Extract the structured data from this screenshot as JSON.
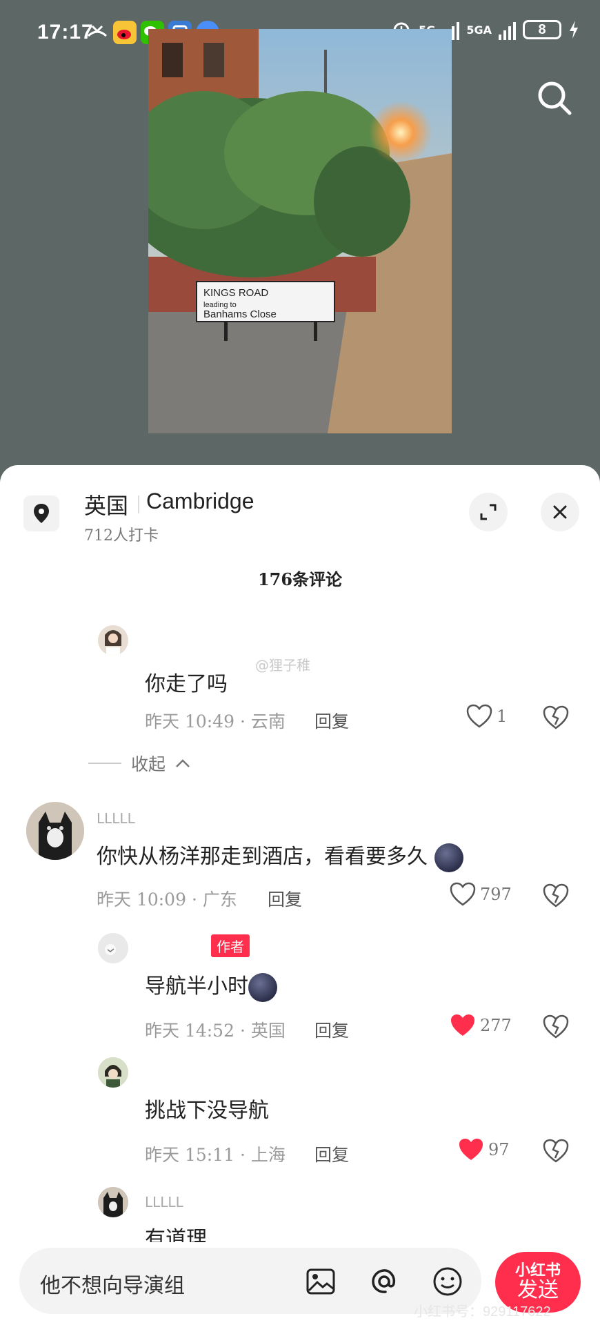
{
  "status_bar": {
    "time": "17:17",
    "network_1": "5G",
    "network_2": "5GA",
    "battery": "8"
  },
  "location": {
    "country": "英国",
    "city": "Cambridge",
    "checkins": "712人打卡"
  },
  "comments_count": "176条评论",
  "watermark": "@狸子稚",
  "comments": [
    {
      "text": "你走了吗",
      "time_location": "昨天 10:49 · 云南",
      "reply": "回复",
      "likes": "1",
      "liked": false
    },
    {
      "name": "LLLLL",
      "text": "你快从杨洋那走到酒店，看看要多久",
      "time_location": "昨天 10:09 · 广东",
      "reply": "回复",
      "likes": "797",
      "liked": false
    },
    {
      "badge": "作者",
      "text": "导航半小时",
      "time_location": "昨天 14:52 · 英国",
      "reply": "回复",
      "likes": "277",
      "liked": true
    },
    {
      "text": "挑战下没导航",
      "time_location": "昨天 15:11 · 上海",
      "reply": "回复",
      "likes": "97",
      "liked": true
    },
    {
      "name": "LLLLL",
      "text": "有道理"
    }
  ],
  "collapse_label": "收起",
  "input": {
    "value": "他不想向导演组"
  },
  "send": {
    "logo": "小红书",
    "label": "发送"
  },
  "rednote_id": "小红书号：929117622",
  "photo": {
    "sign_line1": "KINGS ROAD",
    "sign_line2": "leading to",
    "sign_line3": "Banhams Close"
  },
  "colors": {
    "accent": "#ff2e4d",
    "top_background": "#5d6866"
  }
}
